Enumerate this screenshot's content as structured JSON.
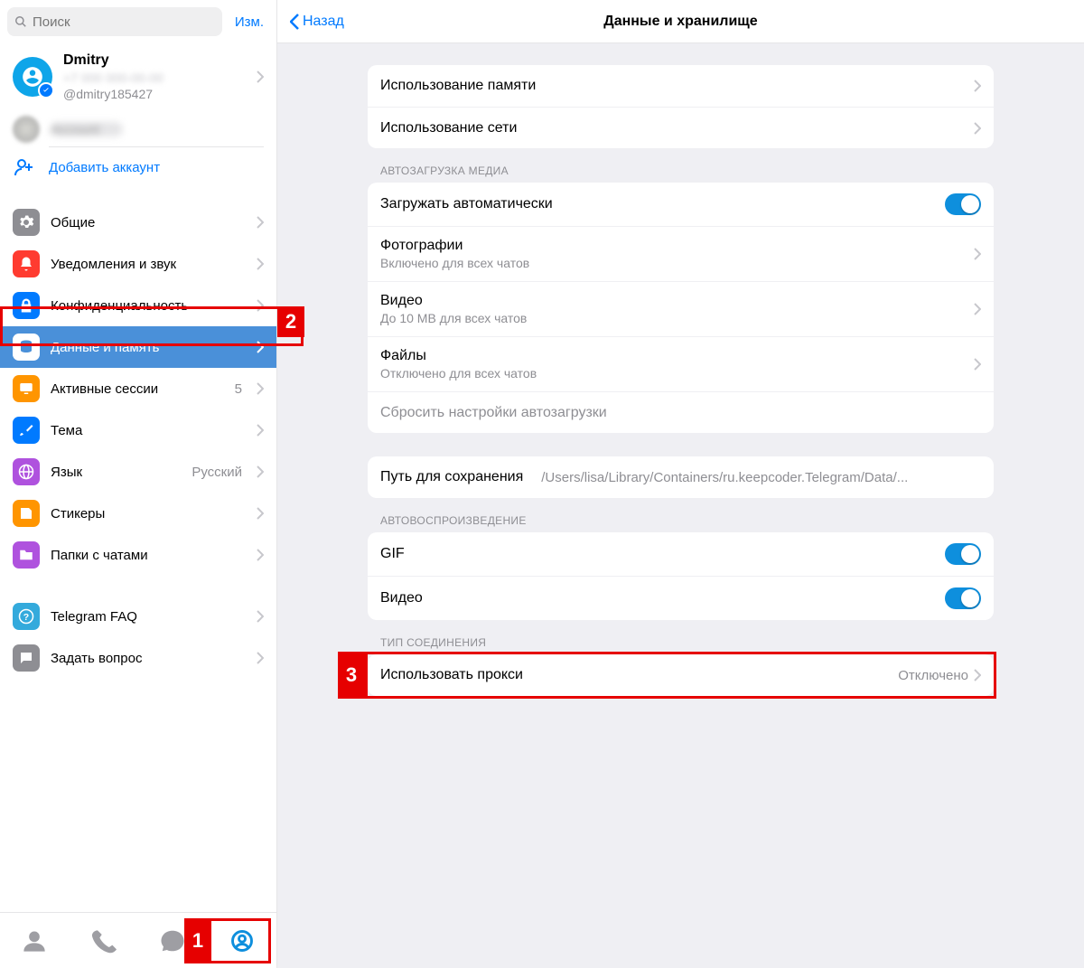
{
  "sidebar": {
    "search_placeholder": "Поиск",
    "edit_label": "Изм.",
    "profile": {
      "name": "Dmitry",
      "phone": "+7 000 000-00-00",
      "username": "@dmitry185427"
    },
    "account2_name": "Account",
    "add_account_label": "Добавить аккаунт",
    "items": {
      "general": {
        "label": "Общие",
        "color": "#8e8e93"
      },
      "notif": {
        "label": "Уведомления и звук",
        "color": "#ff3b30"
      },
      "privacy": {
        "label": "Конфиденциальность",
        "color": "#007aff"
      },
      "data": {
        "label": "Данные и память",
        "color": "#4a90d9"
      },
      "sessions": {
        "label": "Активные сессии",
        "color": "#ff9500",
        "value": "5"
      },
      "theme": {
        "label": "Тема",
        "color": "#007aff"
      },
      "language": {
        "label": "Язык",
        "color": "#af52de",
        "value": "Русский"
      },
      "stickers": {
        "label": "Стикеры",
        "color": "#ff9500"
      },
      "folders": {
        "label": "Папки с чатами",
        "color": "#af52de"
      },
      "faq": {
        "label": "Telegram FAQ",
        "color": "#34aadc"
      },
      "ask": {
        "label": "Задать вопрос",
        "color": "#8e8e93"
      }
    }
  },
  "header": {
    "back_label": "Назад",
    "title": "Данные и хранилище"
  },
  "usage_group": {
    "storage": "Использование памяти",
    "network": "Использование сети"
  },
  "autoload": {
    "header": "АВТОЗАГРУЗКА МЕДИА",
    "auto_label": "Загружать автоматически",
    "photos_label": "Фотографии",
    "photos_sub": "Включено для всех чатов",
    "video_label": "Видео",
    "video_sub": "До 10 MB для всех чатов",
    "files_label": "Файлы",
    "files_sub": "Отключено для всех чатов",
    "reset_label": "Сбросить настройки автозагрузки"
  },
  "savepath": {
    "label": "Путь для сохранения",
    "value": "/Users/lisa/Library/Containers/ru.keepcoder.Telegram/Data/..."
  },
  "autoplay": {
    "header": "АВТОВОСПРОИЗВЕДЕНИЕ",
    "gif_label": "GIF",
    "video_label": "Видео"
  },
  "conn": {
    "header": "ТИП СОЕДИНЕНИЯ",
    "proxy_label": "Использовать прокси",
    "proxy_value": "Отключено"
  },
  "annotations": {
    "1": "1",
    "2": "2",
    "3": "3"
  }
}
